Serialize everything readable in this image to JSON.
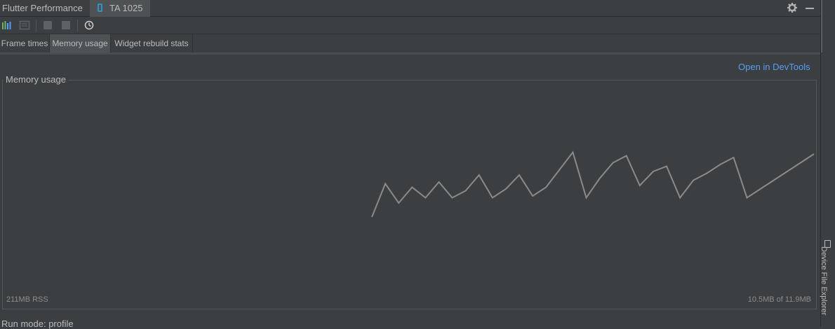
{
  "window": {
    "tool_title": "Flutter Performance",
    "device_tab_label": "TA 1025"
  },
  "tabs": [
    {
      "label": "Frame times",
      "active": false
    },
    {
      "label": "Memory usage",
      "active": true
    },
    {
      "label": "Widget rebuild stats",
      "active": false
    }
  ],
  "toolbar": {
    "icons": [
      "performance-overlay-icon",
      "repaint-rainbow-icon",
      "stop-icon",
      "pause-icon",
      "clock-icon"
    ]
  },
  "content": {
    "open_devtools_link": "Open in DevTools",
    "panel_title": "Memory usage",
    "rss_label": "211MB RSS",
    "heap_label": "10.5MB of 11.9MB"
  },
  "status": {
    "run_mode": "Run mode: profile"
  },
  "side_panel": {
    "label": "Device File Explorer"
  },
  "colors": {
    "background": "#3c3f41",
    "link": "#589df6",
    "series": "#8a8a8a",
    "device_icon": "#3592c4"
  },
  "chart_data": {
    "type": "line",
    "title": "Memory usage",
    "xlabel": "",
    "ylabel": "",
    "grid": false,
    "ylim": [
      0,
      12
    ],
    "series": [
      {
        "values": [
          4.2,
          6.1,
          5.0,
          5.9,
          5.3,
          6.2,
          5.3,
          5.7,
          6.6,
          5.3,
          5.8,
          6.6,
          5.4,
          5.9,
          6.9,
          7.9,
          5.3,
          6.4,
          7.3,
          7.7,
          6.0,
          6.8,
          7.1,
          5.3,
          6.3,
          6.7,
          7.2,
          7.6,
          5.3,
          5.8,
          6.3,
          6.8,
          7.3,
          7.8
        ]
      }
    ]
  }
}
